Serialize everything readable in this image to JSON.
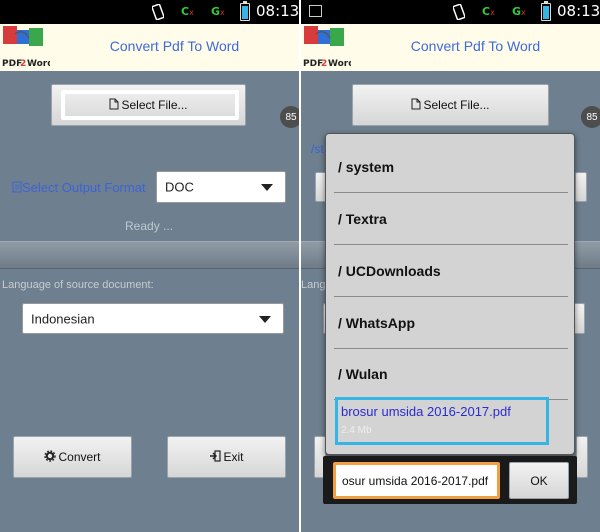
{
  "status_bar": {
    "time": "08:13",
    "signal_1": "C",
    "signal_2": "G",
    "signal_x": "x"
  },
  "app": {
    "title": "Convert Pdf To Word",
    "logo_text_pdf": "PDF",
    "logo_text_2": "2",
    "logo_text_word": "Word"
  },
  "left": {
    "select_file_label": "Select File...",
    "progress_badge": "85",
    "output_format_label": "Select Output Format",
    "output_format_value": "DOC",
    "status_text": "Ready ...",
    "language_label": "Language of source document:",
    "language_value": "Indonesian",
    "convert_label": "Convert",
    "exit_label": "Exit"
  },
  "right": {
    "select_file_label": "Select File...",
    "progress_badge": "85",
    "path_fragment": "/st",
    "language_fragment": "Lang",
    "file_dialog": {
      "folders": [
        "/ system",
        "/ Textra",
        "/ UCDownloads",
        "/ WhatsApp",
        "/ Wulan"
      ],
      "selected_file_name": "brosur umsida 2016-2017.pdf",
      "selected_file_size": "2.4 Mb",
      "filename_value": "osur umsida 2016-2017.pdf",
      "ok_label": "OK"
    }
  },
  "colors": {
    "accent": "#33b5e5",
    "highlight": "#f0a040",
    "title_blue": "#3f6ad8",
    "background": "#6e7f8f"
  }
}
